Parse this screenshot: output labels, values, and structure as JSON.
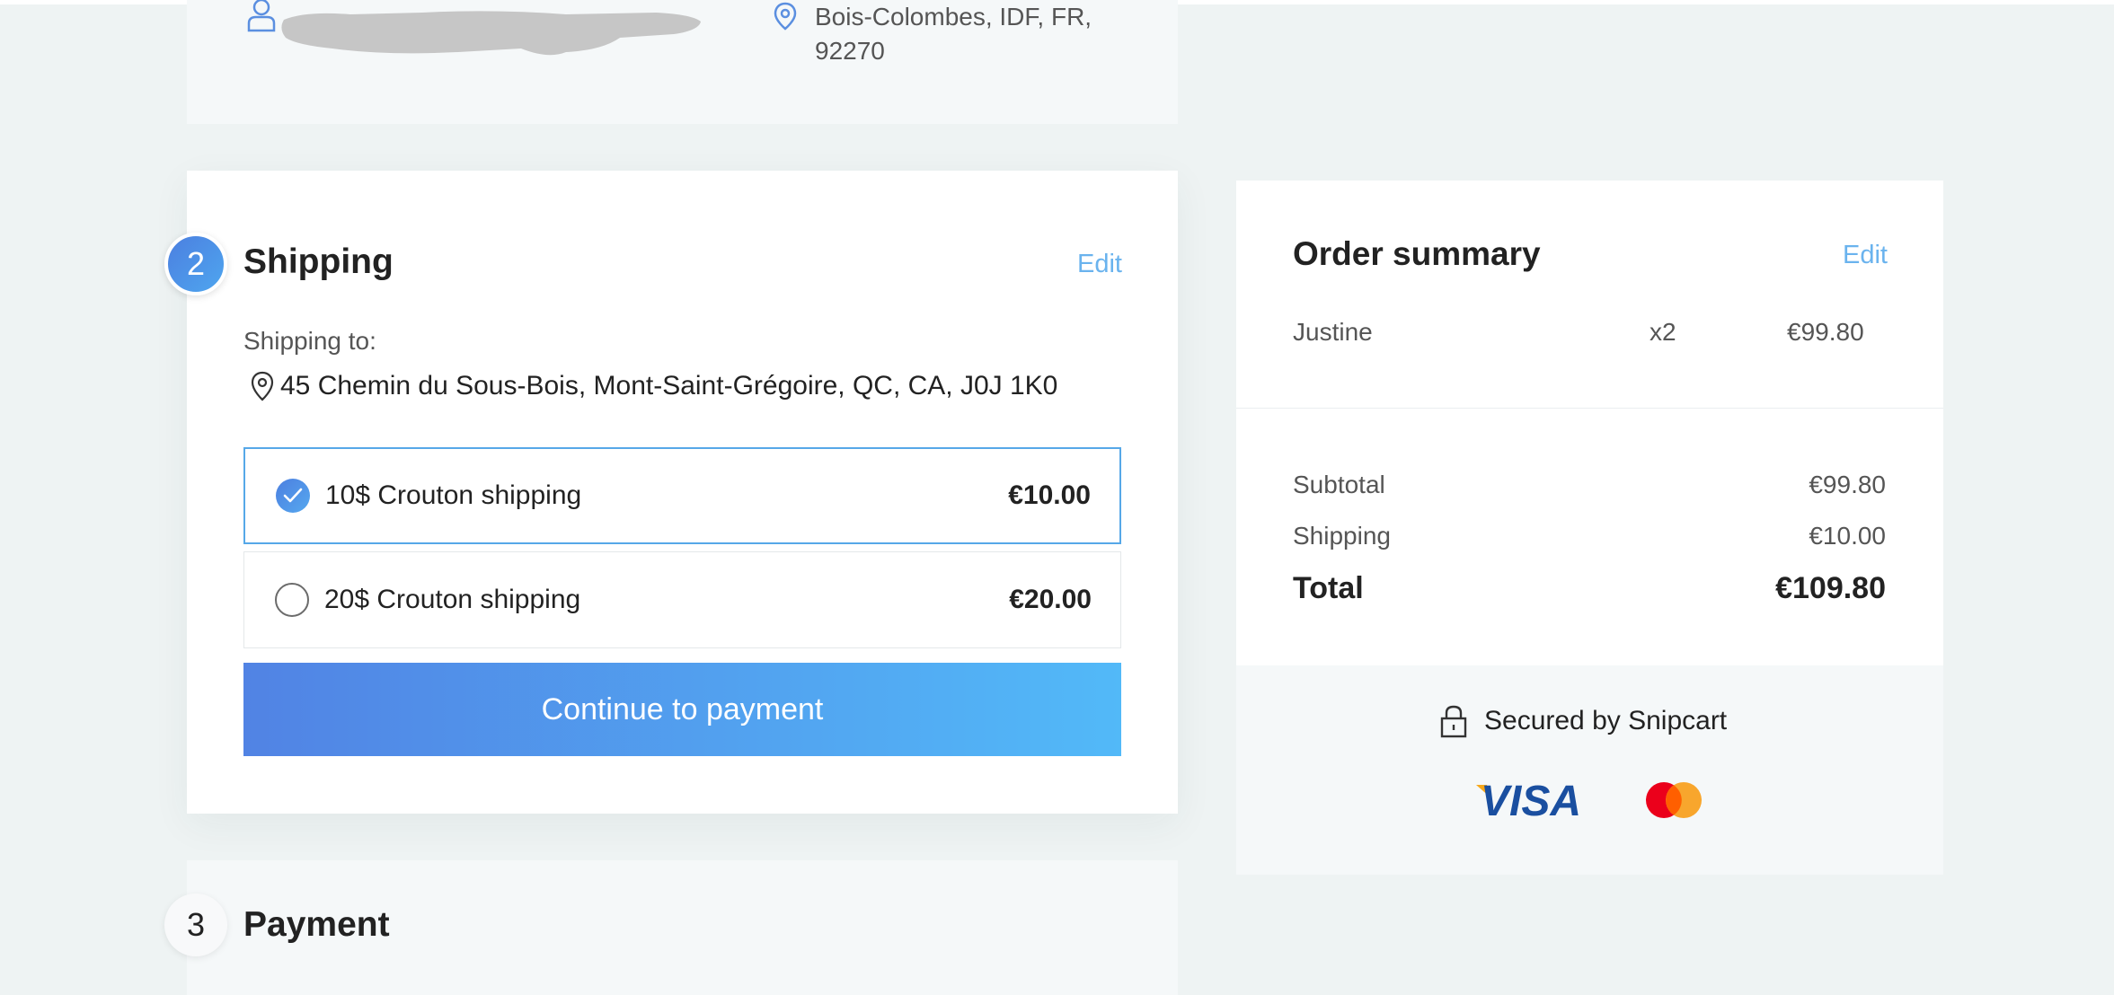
{
  "customer": {
    "address_line1": "Bois-Colombes, IDF, FR,",
    "address_line2": "92270"
  },
  "shipping": {
    "step_number": "2",
    "title": "Shipping",
    "edit_label": "Edit",
    "shipping_to_label": "Shipping to:",
    "address": "45 Chemin du Sous-Bois, Mont-Saint-Grégoire, QC, CA, J0J 1K0",
    "options": [
      {
        "label": "10$ Crouton shipping",
        "price": "€10.00",
        "selected": true
      },
      {
        "label": "20$ Crouton shipping",
        "price": "€20.00",
        "selected": false
      }
    ],
    "continue_label": "Continue to payment"
  },
  "payment": {
    "step_number": "3",
    "title": "Payment"
  },
  "summary": {
    "title": "Order summary",
    "edit_label": "Edit",
    "items": [
      {
        "name": "Justine",
        "qty": "x2",
        "price": "€99.80"
      }
    ],
    "subtotal_label": "Subtotal",
    "subtotal_value": "€99.80",
    "shipping_label": "Shipping",
    "shipping_value": "€10.00",
    "total_label": "Total",
    "total_value": "€109.80",
    "secured_text": "Secured by Snipcart",
    "visa_text": "VISA"
  },
  "colors": {
    "accent_blue": "#4c7fe0",
    "accent_light_blue": "#52b9f8",
    "link_blue": "#6ab3ee",
    "page_bg": "#eef3f3",
    "visa_blue": "#1a4fa0",
    "visa_orange": "#f7a81b",
    "mastercard_red": "#eb001b",
    "mastercard_orange": "#f79e1b"
  }
}
